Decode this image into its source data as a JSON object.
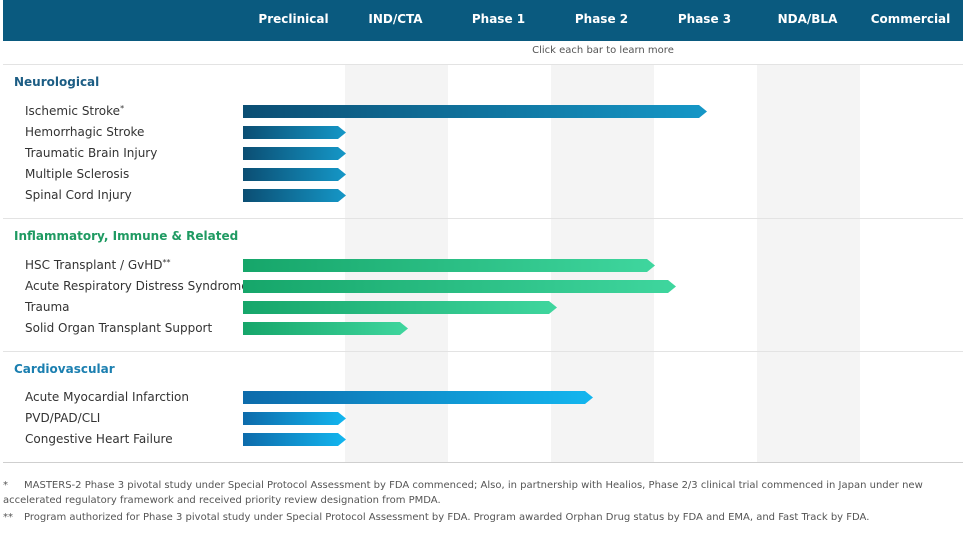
{
  "phases": [
    "Preclinical",
    "IND/CTA",
    "Phase 1",
    "Phase 2",
    "Phase 3",
    "NDA/BLA",
    "Commercial"
  ],
  "hint": "Click each bar to learn more",
  "colors": {
    "header": "#0a5a7f",
    "neuro": [
      "#0b4e73",
      "#1597c7"
    ],
    "inflam": [
      "#16a66a",
      "#3fd69e"
    ],
    "cardio": [
      "#0d6bab",
      "#13b6ef"
    ],
    "neuro_title": "#1c5d84",
    "inflam_title": "#1f9a62",
    "cardio_title": "#1b7fb0"
  },
  "sections": [
    {
      "title": "Neurological",
      "items": [
        {
          "label": "Ischemic Stroke",
          "note": "*",
          "progress": 4.5
        },
        {
          "label": "Hemorrhagic Stroke",
          "note": "",
          "progress": 1.0
        },
        {
          "label": "Traumatic Brain Injury",
          "note": "",
          "progress": 1.0
        },
        {
          "label": "Multiple Sclerosis",
          "note": "",
          "progress": 1.0
        },
        {
          "label": "Spinal Cord Injury",
          "note": "",
          "progress": 1.0
        }
      ]
    },
    {
      "title": "Inflammatory, Immune & Related",
      "items": [
        {
          "label": "HSC Transplant / GvHD",
          "note": "**",
          "progress": 4.0
        },
        {
          "label": "Acute Respiratory Distress Syndrome",
          "note": "",
          "progress": 4.2
        },
        {
          "label": "Trauma",
          "note": "",
          "progress": 3.05
        },
        {
          "label": "Solid Organ Transplant Support",
          "note": "",
          "progress": 1.6
        }
      ]
    },
    {
      "title": "Cardiovascular",
      "items": [
        {
          "label": "Acute Myocardial Infarction",
          "note": "",
          "progress": 3.4
        },
        {
          "label": "PVD/PAD/CLI",
          "note": "",
          "progress": 1.0
        },
        {
          "label": "Congestive Heart Failure",
          "note": "",
          "progress": 1.0
        }
      ]
    }
  ],
  "footnotes": [
    {
      "mark": "*",
      "text": "MASTERS-2 Phase 3 pivotal study under Special Protocol Assessment by FDA commenced; Also, in partnership with Healios, Phase 2/3 clinical trial commenced in Japan under new accelerated regulatory framework and received priority review designation from PMDA."
    },
    {
      "mark": "**",
      "text": "Program authorized for Phase 3 pivotal study under Special Protocol Assessment by FDA. Program awarded Orphan Drug status by FDA and EMA, and Fast Track by FDA."
    }
  ]
}
